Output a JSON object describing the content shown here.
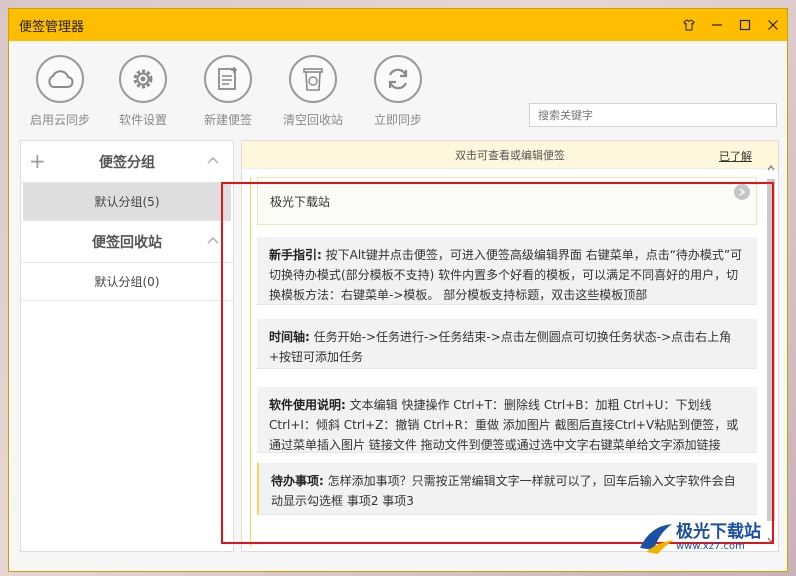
{
  "window": {
    "title": "便签管理器"
  },
  "toolbar": {
    "items": [
      {
        "label": "启用云同步",
        "icon": "cloud-icon"
      },
      {
        "label": "软件设置",
        "icon": "gear-icon"
      },
      {
        "label": "新建便签",
        "icon": "new-note-icon"
      },
      {
        "label": "清空回收站",
        "icon": "recycle-bin-icon"
      },
      {
        "label": "立即同步",
        "icon": "refresh-icon"
      }
    ]
  },
  "search": {
    "placeholder": "搜索关键字"
  },
  "sidebar": {
    "groups_title": "便签分组",
    "groups": [
      {
        "label": "默认分组(5)"
      }
    ],
    "recycle_title": "便签回收站",
    "recycle": [
      {
        "label": "默认分组(0)"
      }
    ]
  },
  "hintbar": {
    "text": "双击可查看或编辑便签",
    "dismiss": "已了解"
  },
  "notes": [
    {
      "title": "",
      "body": "极光下载站"
    },
    {
      "title": "新手指引:",
      "body": "按下Alt键并点击便签，可进入便签高级编辑界面 右键菜单，点击“待办模式”可切换待办模式(部分模板不支持) 软件内置多个好看的模板，可以满足不同喜好的用户，切换模板方法：右键菜单->模板。 部分模板支持标题，双击这些模板顶部"
    },
    {
      "title": "时间轴:",
      "body": "任务开始->任务进行->任务结束->点击左侧圆点可切换任务状态->点击右上角+按钮可添加任务"
    },
    {
      "title": "软件使用说明:",
      "body": "文本编辑 快捷操作 Ctrl+T：删除线 Ctrl+B：加粗 Ctrl+U：下划线 Ctrl+I：倾斜 Ctrl+Z：撤销 Ctrl+R：重做 添加图片 截图后直接Ctrl+V粘贴到便签，或通过菜单插入图片 链接文件 拖动文件到便签或通过选中文字右键菜单给文字添加链接"
    },
    {
      "title": "待办事项:",
      "body": "怎样添加事项？只需按正常编辑文字一样就可以了，回车后输入文字软件会自动显示勾选框 事项2 事项3"
    }
  ],
  "watermark": {
    "name": "极光下载站",
    "url": "www.xz7.com"
  },
  "colors": {
    "titlebar": "#ffbd00",
    "highlight": "#e0141b",
    "watermark": "#1a4fa3"
  }
}
